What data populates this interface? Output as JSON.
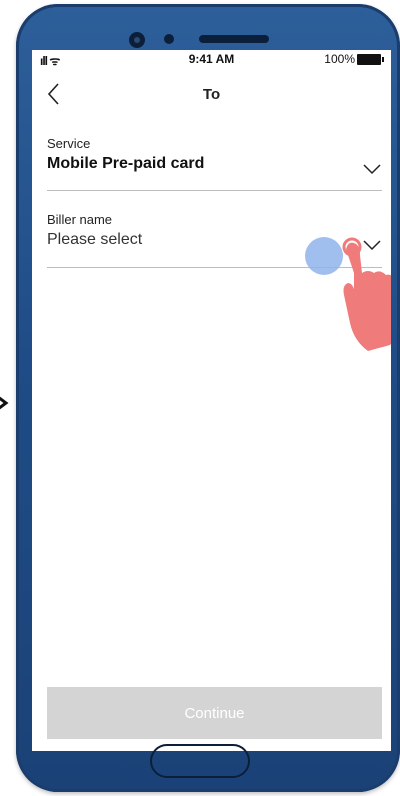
{
  "status_bar": {
    "signal": "▏▎▍▌",
    "time": "9:41 AM",
    "battery_percent": "100%"
  },
  "header": {
    "title": "To",
    "back_icon": "chevron-left-icon"
  },
  "service_field": {
    "label": "Service",
    "value": "Mobile Pre-paid card",
    "icon": "chevron-down-icon"
  },
  "biller_field": {
    "label": "Biller name",
    "placeholder": "Please select",
    "icon": "chevron-down-icon"
  },
  "continue_button": {
    "label": "Continue",
    "enabled": false
  },
  "colors": {
    "phone_frame": "#1f4c86",
    "disabled_button": "#d4d4d4",
    "touch_indicator": "#8fb4ec",
    "hand_pointer": "#f07b7b"
  }
}
